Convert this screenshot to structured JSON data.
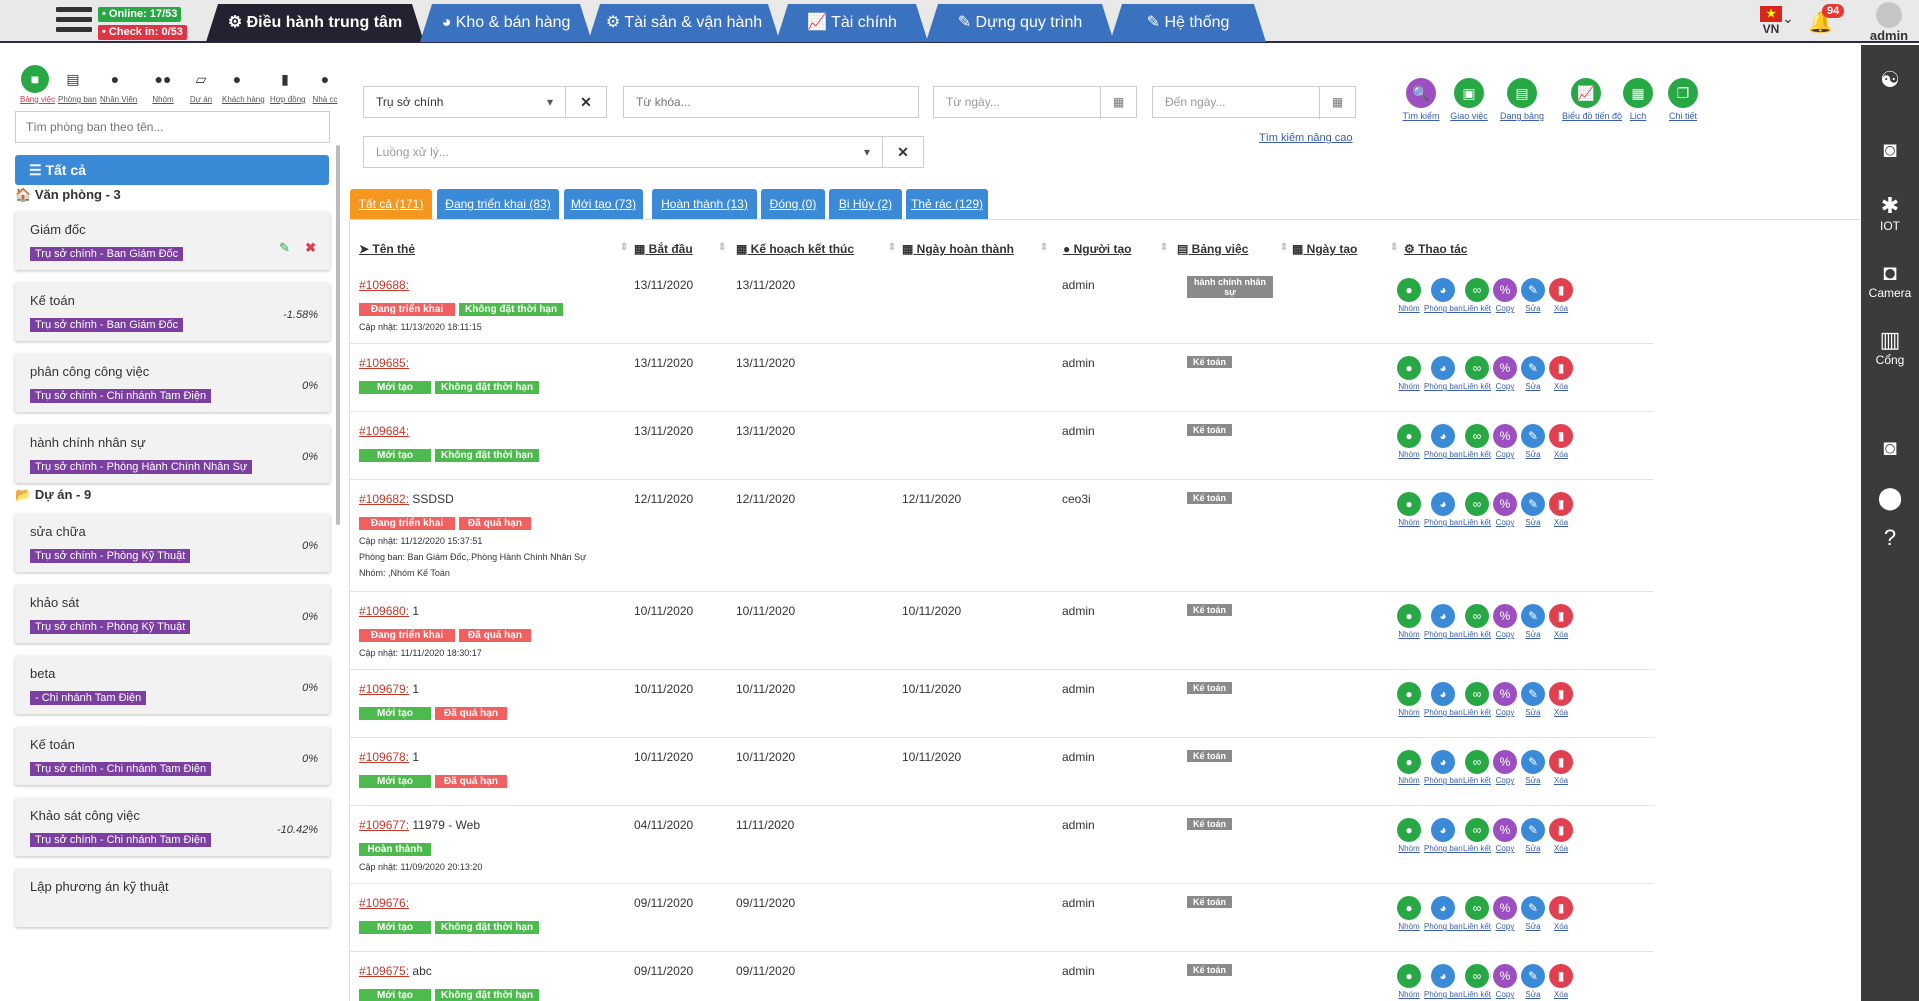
{
  "topbar": {
    "online": "• Online: 17/53",
    "checkin": "• Check in: 0/53",
    "tabs": [
      "⚙ Điều hành trung tâm",
      "◕ Kho & bán hàng",
      "⚙ Tài sản & vận hành",
      "📈 Tài chính",
      "✎ Dựng quy trình",
      "✎ Hệ thống"
    ],
    "lang": "VN",
    "flag": "★",
    "notif_count": "94",
    "user": "admin"
  },
  "sidebar": {
    "icons": [
      {
        "label": "Bảng việc",
        "icon": "■"
      },
      {
        "label": "Phòng ban",
        "icon": "▤"
      },
      {
        "label": "Nhân Viên",
        "icon": "●"
      },
      {
        "label": "Nhóm",
        "icon": "●●"
      },
      {
        "label": "Dự án",
        "icon": "▱"
      },
      {
        "label": "Khách hàng",
        "icon": "●"
      },
      {
        "label": "Hợp đồng",
        "icon": "▮"
      },
      {
        "label": "Nhà cc",
        "icon": "●"
      }
    ],
    "search_placeholder": "Tìm phòng ban theo tên...",
    "all_label": "☰   Tất cả",
    "group1": "Văn phòng - 3",
    "group2": "Dự án - 9",
    "cards": [
      {
        "name": "Giám đốc",
        "tag": "Trụ sở chính - Ban Giám Đốc",
        "pct": ""
      },
      {
        "name": "Kế toán",
        "tag": "Trụ sở chính - Ban Giám Đốc",
        "pct": "-1.58%"
      },
      {
        "name": "phân công công việc",
        "tag": "Trụ sở chính - Chi nhánh Tam Điện",
        "pct": "0%"
      },
      {
        "name": "hành chính nhân sự",
        "tag": "Trụ sở chính - Phòng Hành Chính Nhân Sự",
        "pct": "0%"
      },
      {
        "name": "sửa chữa",
        "tag": "Trụ sở chính - Phòng Kỹ Thuật",
        "pct": "0%"
      },
      {
        "name": "khảo sát",
        "tag": "Trụ sở chính - Phòng Kỹ Thuật",
        "pct": "0%"
      },
      {
        "name": "beta",
        "tag": " - Chi nhánh Tam Điện",
        "pct": "0%"
      },
      {
        "name": "Kế toán",
        "tag": "Trụ sở chính - Chi nhánh Tam Điện",
        "pct": "0%"
      },
      {
        "name": "Khảo sát công việc",
        "tag": "Trụ sở chính - Chi nhánh Tam Điện",
        "pct": "-10.42%"
      },
      {
        "name": "Lập phương án kỹ thuật",
        "tag": "",
        "pct": ""
      }
    ]
  },
  "rightbar": [
    {
      "icon": "☯",
      "label": ""
    },
    {
      "icon": "◙",
      "label": ""
    },
    {
      "icon": "✱",
      "label": "IOT"
    },
    {
      "icon": "◘",
      "label": "Camera"
    },
    {
      "icon": "▥",
      "label": "Cổng"
    },
    {
      "icon": "◙",
      "label": ""
    },
    {
      "icon": "⬤",
      "label": ""
    },
    {
      "icon": "?",
      "label": ""
    }
  ],
  "filters": {
    "branch": "Trụ sở chính",
    "keyword_ph": "Từ khóa...",
    "from_ph": "Từ ngày...",
    "to_ph": "Đến ngày...",
    "flow_ph": "Luồng xử lý...",
    "advanced": "Tìm kiếm nâng cao"
  },
  "toolbar": [
    {
      "label": "Tìm kiếm",
      "icon": "🔍",
      "color": "#9b4fc0"
    },
    {
      "label": "Giao việc",
      "icon": "▣",
      "color": "#28a745"
    },
    {
      "label": "Dạng bảng",
      "icon": "▤",
      "color": "#28a745"
    },
    {
      "label": "Biểu đồ tiến độ",
      "icon": "📈",
      "color": "#28a745"
    },
    {
      "label": "Lịch",
      "icon": "▦",
      "color": "#28a745"
    },
    {
      "label": "Chi tiết",
      "icon": "❐",
      "color": "#28a745"
    }
  ],
  "subtabs": [
    "Tất cả (171)",
    "Đang triển khai (83)",
    "Mới tạo (73)",
    "Hoàn thành (13)",
    "Đóng (0)",
    "Bị Hủy (2)",
    "Thẻ rác (129)"
  ],
  "columns": [
    "Tên thẻ",
    "Bắt đầu",
    "Kế hoạch kết thúc",
    "Ngày hoàn thành",
    "Người tạo",
    "Bảng việc",
    "Ngày tạo",
    "Thao tác"
  ],
  "actions": [
    {
      "label": "Nhóm",
      "icon": "●",
      "color": "#28a745"
    },
    {
      "label": "Phòng ban",
      "icon": "◕",
      "color": "#3a8ad8"
    },
    {
      "label": "Liên kết",
      "icon": "∞",
      "color": "#28a745"
    },
    {
      "label": "Copy",
      "icon": "%",
      "color": "#9b4fc0"
    },
    {
      "label": "Sửa",
      "icon": "✎",
      "color": "#3a8ad8"
    },
    {
      "label": "Xóa",
      "icon": "▮",
      "color": "#e04050"
    }
  ],
  "rows": [
    {
      "id": "#109688:",
      "title": "",
      "start": "13/11/2020",
      "plan": "13/11/2020",
      "done": "",
      "creator": "admin",
      "board": "hành chính nhân sự",
      "badges": [
        [
          "Đang triển khai",
          "red"
        ],
        [
          "Không đặt thời hạn",
          "green"
        ]
      ],
      "notes": [
        "Cập nhật: 11/13/2020 18:11:15"
      ]
    },
    {
      "id": "#109685:",
      "title": "",
      "start": "13/11/2020",
      "plan": "13/11/2020",
      "done": "",
      "creator": "admin",
      "board": "Kế toán",
      "badges": [
        [
          "Mới tạo",
          "green"
        ],
        [
          "Không đặt thời hạn",
          "green"
        ]
      ],
      "notes": []
    },
    {
      "id": "#109684:",
      "title": "",
      "start": "13/11/2020",
      "plan": "13/11/2020",
      "done": "",
      "creator": "admin",
      "board": "Kế toán",
      "badges": [
        [
          "Mới tạo",
          "green"
        ],
        [
          "Không đặt thời hạn",
          "green"
        ]
      ],
      "notes": []
    },
    {
      "id": "#109682:",
      "title": " SSDSD",
      "start": "12/11/2020",
      "plan": "12/11/2020",
      "done": "12/11/2020",
      "creator": "ceo3i",
      "board": "Kế toán",
      "badges": [
        [
          "Đang triển khai",
          "red"
        ],
        [
          "Đã quá hạn",
          "red"
        ]
      ],
      "notes": [
        "Cập nhật: 11/12/2020 15:37:51",
        "Phòng ban: Ban Giám Đốc,.Phòng Hành Chính Nhân Sự",
        "Nhóm: ,Nhóm Kế Toán"
      ]
    },
    {
      "id": "#109680:",
      "title": " 1",
      "start": "10/11/2020",
      "plan": "10/11/2020",
      "done": "10/11/2020",
      "creator": "admin",
      "board": "Kế toán",
      "badges": [
        [
          "Đang triển khai",
          "red"
        ],
        [
          "Đã quá hạn",
          "red"
        ]
      ],
      "notes": [
        "Cập nhật: 11/11/2020 18:30:17"
      ]
    },
    {
      "id": "#109679:",
      "title": " 1",
      "start": "10/11/2020",
      "plan": "10/11/2020",
      "done": "10/11/2020",
      "creator": "admin",
      "board": "Kế toán",
      "badges": [
        [
          "Mới tạo",
          "green"
        ],
        [
          "Đã quá hạn",
          "red"
        ]
      ],
      "notes": []
    },
    {
      "id": "#109678:",
      "title": " 1",
      "start": "10/11/2020",
      "plan": "10/11/2020",
      "done": "10/11/2020",
      "creator": "admin",
      "board": "Kế toán",
      "badges": [
        [
          "Mới tạo",
          "green"
        ],
        [
          "Đã quá hạn",
          "red"
        ]
      ],
      "notes": []
    },
    {
      "id": "#109677:",
      "title": " 11979 - Web",
      "start": "04/11/2020",
      "plan": "11/11/2020",
      "done": "",
      "creator": "admin",
      "board": "Kế toán",
      "badges": [
        [
          "Hoàn thành",
          "green"
        ]
      ],
      "notes": [
        "Cập nhật: 11/09/2020 20:13:20"
      ]
    },
    {
      "id": "#109676:",
      "title": "",
      "start": "09/11/2020",
      "plan": "09/11/2020",
      "done": "",
      "creator": "admin",
      "board": "Kế toán",
      "badges": [
        [
          "Mới tạo",
          "green"
        ],
        [
          "Không đặt thời hạn",
          "green"
        ]
      ],
      "notes": []
    },
    {
      "id": "#109675:",
      "title": " abc",
      "start": "09/11/2020",
      "plan": "09/11/2020",
      "done": "",
      "creator": "admin",
      "board": "Kế toán",
      "badges": [
        [
          "Mới tạo",
          "green"
        ],
        [
          "Không đặt thời hạn",
          "green"
        ]
      ],
      "notes": []
    }
  ]
}
